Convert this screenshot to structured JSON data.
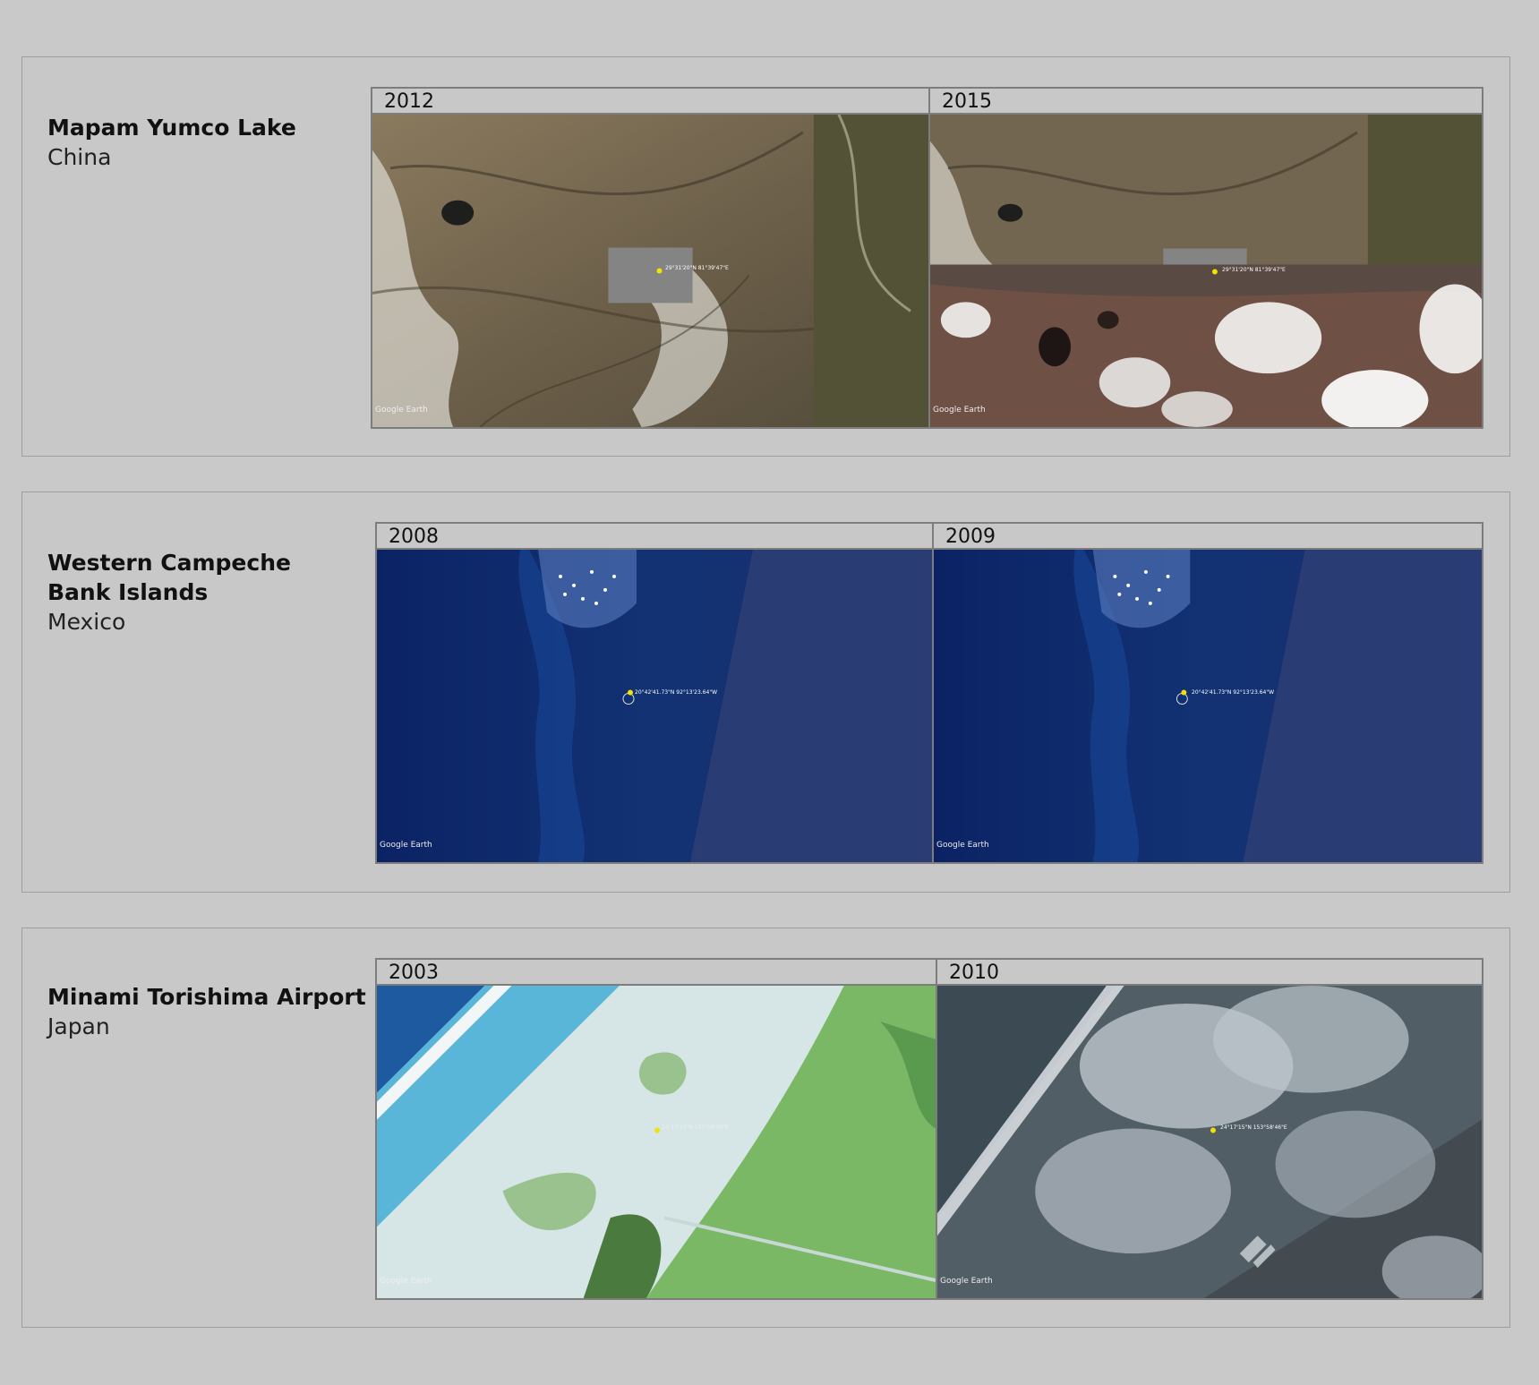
{
  "sites": [
    {
      "title": "Mapam Yumco Lake",
      "country": "China",
      "panels": [
        {
          "year": "2012",
          "watermark": "Google Earth"
        },
        {
          "year": "2015",
          "watermark": "Google Earth"
        }
      ]
    },
    {
      "title": "Western Campeche Bank Islands",
      "country": "Mexico",
      "panels": [
        {
          "year": "2008",
          "watermark": "Google Earth",
          "coordinate": "20°42'41.73\"N 92°13'23.64\"W"
        },
        {
          "year": "2009",
          "watermark": "Google Earth",
          "coordinate": "20°42'41.73\"N 92°13'23.64\"W"
        }
      ]
    },
    {
      "title": "Minami Torishima Airport",
      "country": "Japan",
      "panels": [
        {
          "year": "2003",
          "watermark": "Google Earth"
        },
        {
          "year": "2010",
          "watermark": "Google Earth"
        }
      ]
    }
  ]
}
